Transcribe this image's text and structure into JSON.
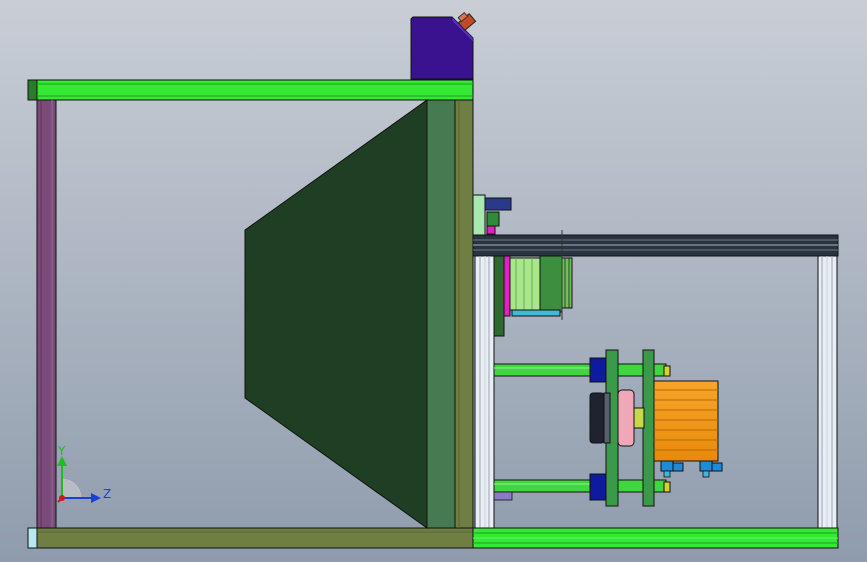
{
  "view": {
    "background_top": "#c9ced6",
    "background_bottom": "#8f9cad"
  },
  "triad": {
    "y_label": "Y",
    "z_label": "Z",
    "y_color": "#18c018",
    "z_color": "#1a3fd6",
    "x_color": "#d01818"
  },
  "colors": {
    "frame_green": "#34e834",
    "frame_olive": "#6f7f43",
    "post_purple": "#7a4a78",
    "panel_dark": "#1f3f24",
    "panel_edge": "#467a51",
    "hopper_blue": "#3a1290",
    "motor_orange": "#f59a16",
    "rail_dark": "#2a3340",
    "rod_green": "#3fd63f",
    "bearing_navy": "#0f1b9e",
    "coupling_pink": "#f0a8b8"
  }
}
